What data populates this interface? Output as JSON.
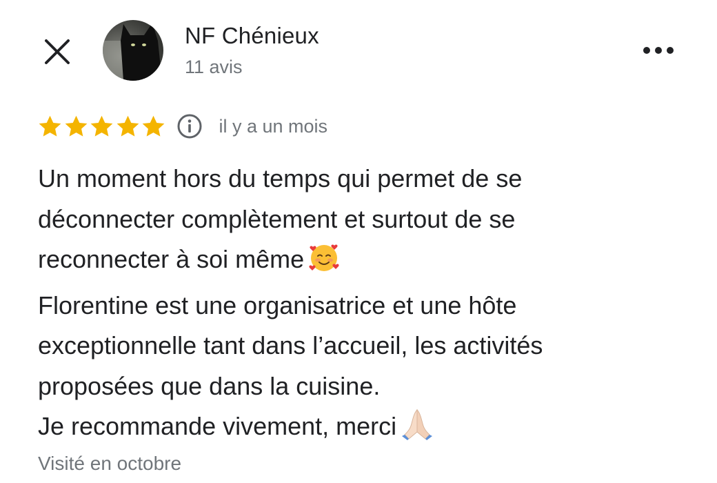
{
  "author": {
    "name": "NF Chénieux",
    "meta": "11 avis"
  },
  "review": {
    "rating": 5,
    "rating_max": 5,
    "date": "il y a un mois",
    "lines": [
      "Un moment hors du temps qui permet de se",
      "déconnecter complètement et surtout de se",
      "reconnecter à soi même",
      "Florentine est une organisatrice et une hôte",
      "exceptionnelle tant dans l’accueil, les activités",
      "proposées que dans la cuisine.",
      "Je recommande vivement, merci"
    ],
    "visited": "Visité en octobre"
  },
  "icons": {
    "close": "close-icon",
    "more": "more-horizontal-icon",
    "info": "info-icon",
    "star": "star-icon",
    "emoji_1": "smiling-face-with-hearts-emoji",
    "emoji_2": "folded-hands-emoji"
  },
  "colors": {
    "star": "#f4b400",
    "text_primary": "#202124",
    "text_secondary": "#70757a"
  }
}
